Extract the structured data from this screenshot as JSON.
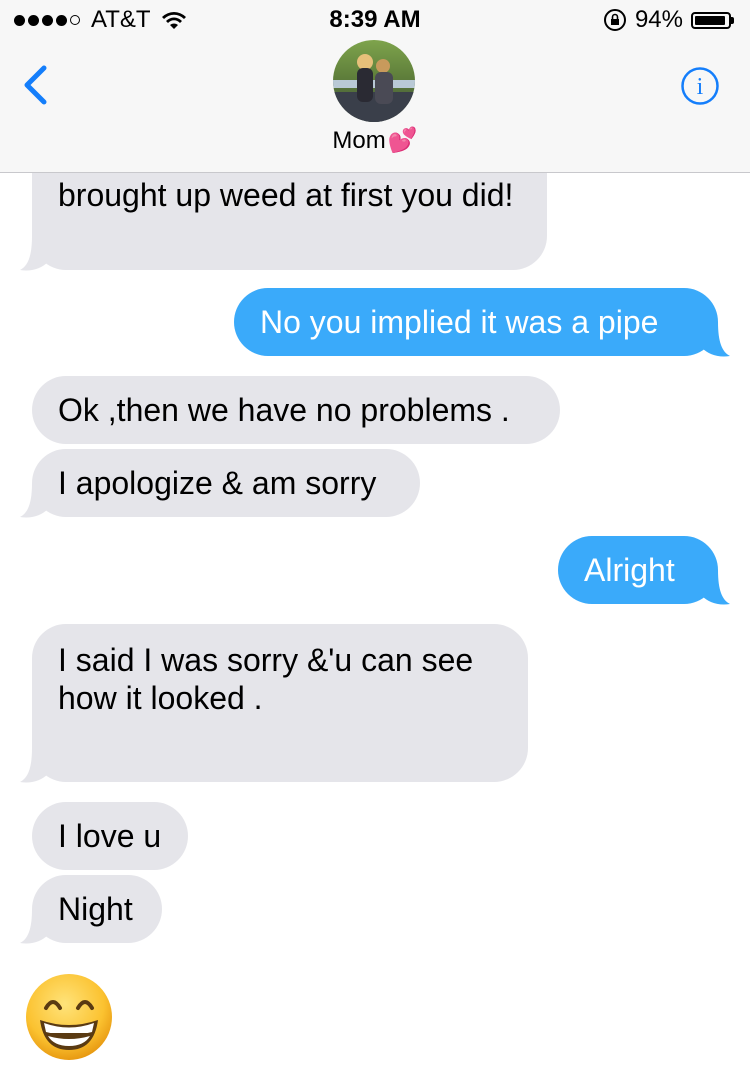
{
  "status_bar": {
    "carrier": "AT&T",
    "time": "8:39 AM",
    "battery": "94%",
    "battery_level": 0.94
  },
  "header": {
    "contact_name": "Mom",
    "name_emoji": "💕",
    "back_icon": "chevron-left-icon",
    "info_icon": "info-icon"
  },
  "messages": [
    {
      "direction": "incoming",
      "text": "brought up weed at first you did!"
    },
    {
      "direction": "outgoing",
      "text": "No you implied it was a pipe"
    },
    {
      "direction": "incoming",
      "text": "Ok ,then we have no problems ."
    },
    {
      "direction": "incoming",
      "text": "I apologize & am sorry"
    },
    {
      "direction": "outgoing",
      "text": "Alright"
    },
    {
      "direction": "incoming",
      "text": "I said I was sorry &'u can see how it looked ."
    },
    {
      "direction": "incoming",
      "text": "I love u"
    },
    {
      "direction": "incoming",
      "text": "Night"
    },
    {
      "direction": "incoming",
      "text": "",
      "emoji": "grinning-face"
    }
  ],
  "colors": {
    "outgoing_bubble": "#3aaafa",
    "incoming_bubble": "#e5e5ea",
    "accent": "#147efb"
  }
}
